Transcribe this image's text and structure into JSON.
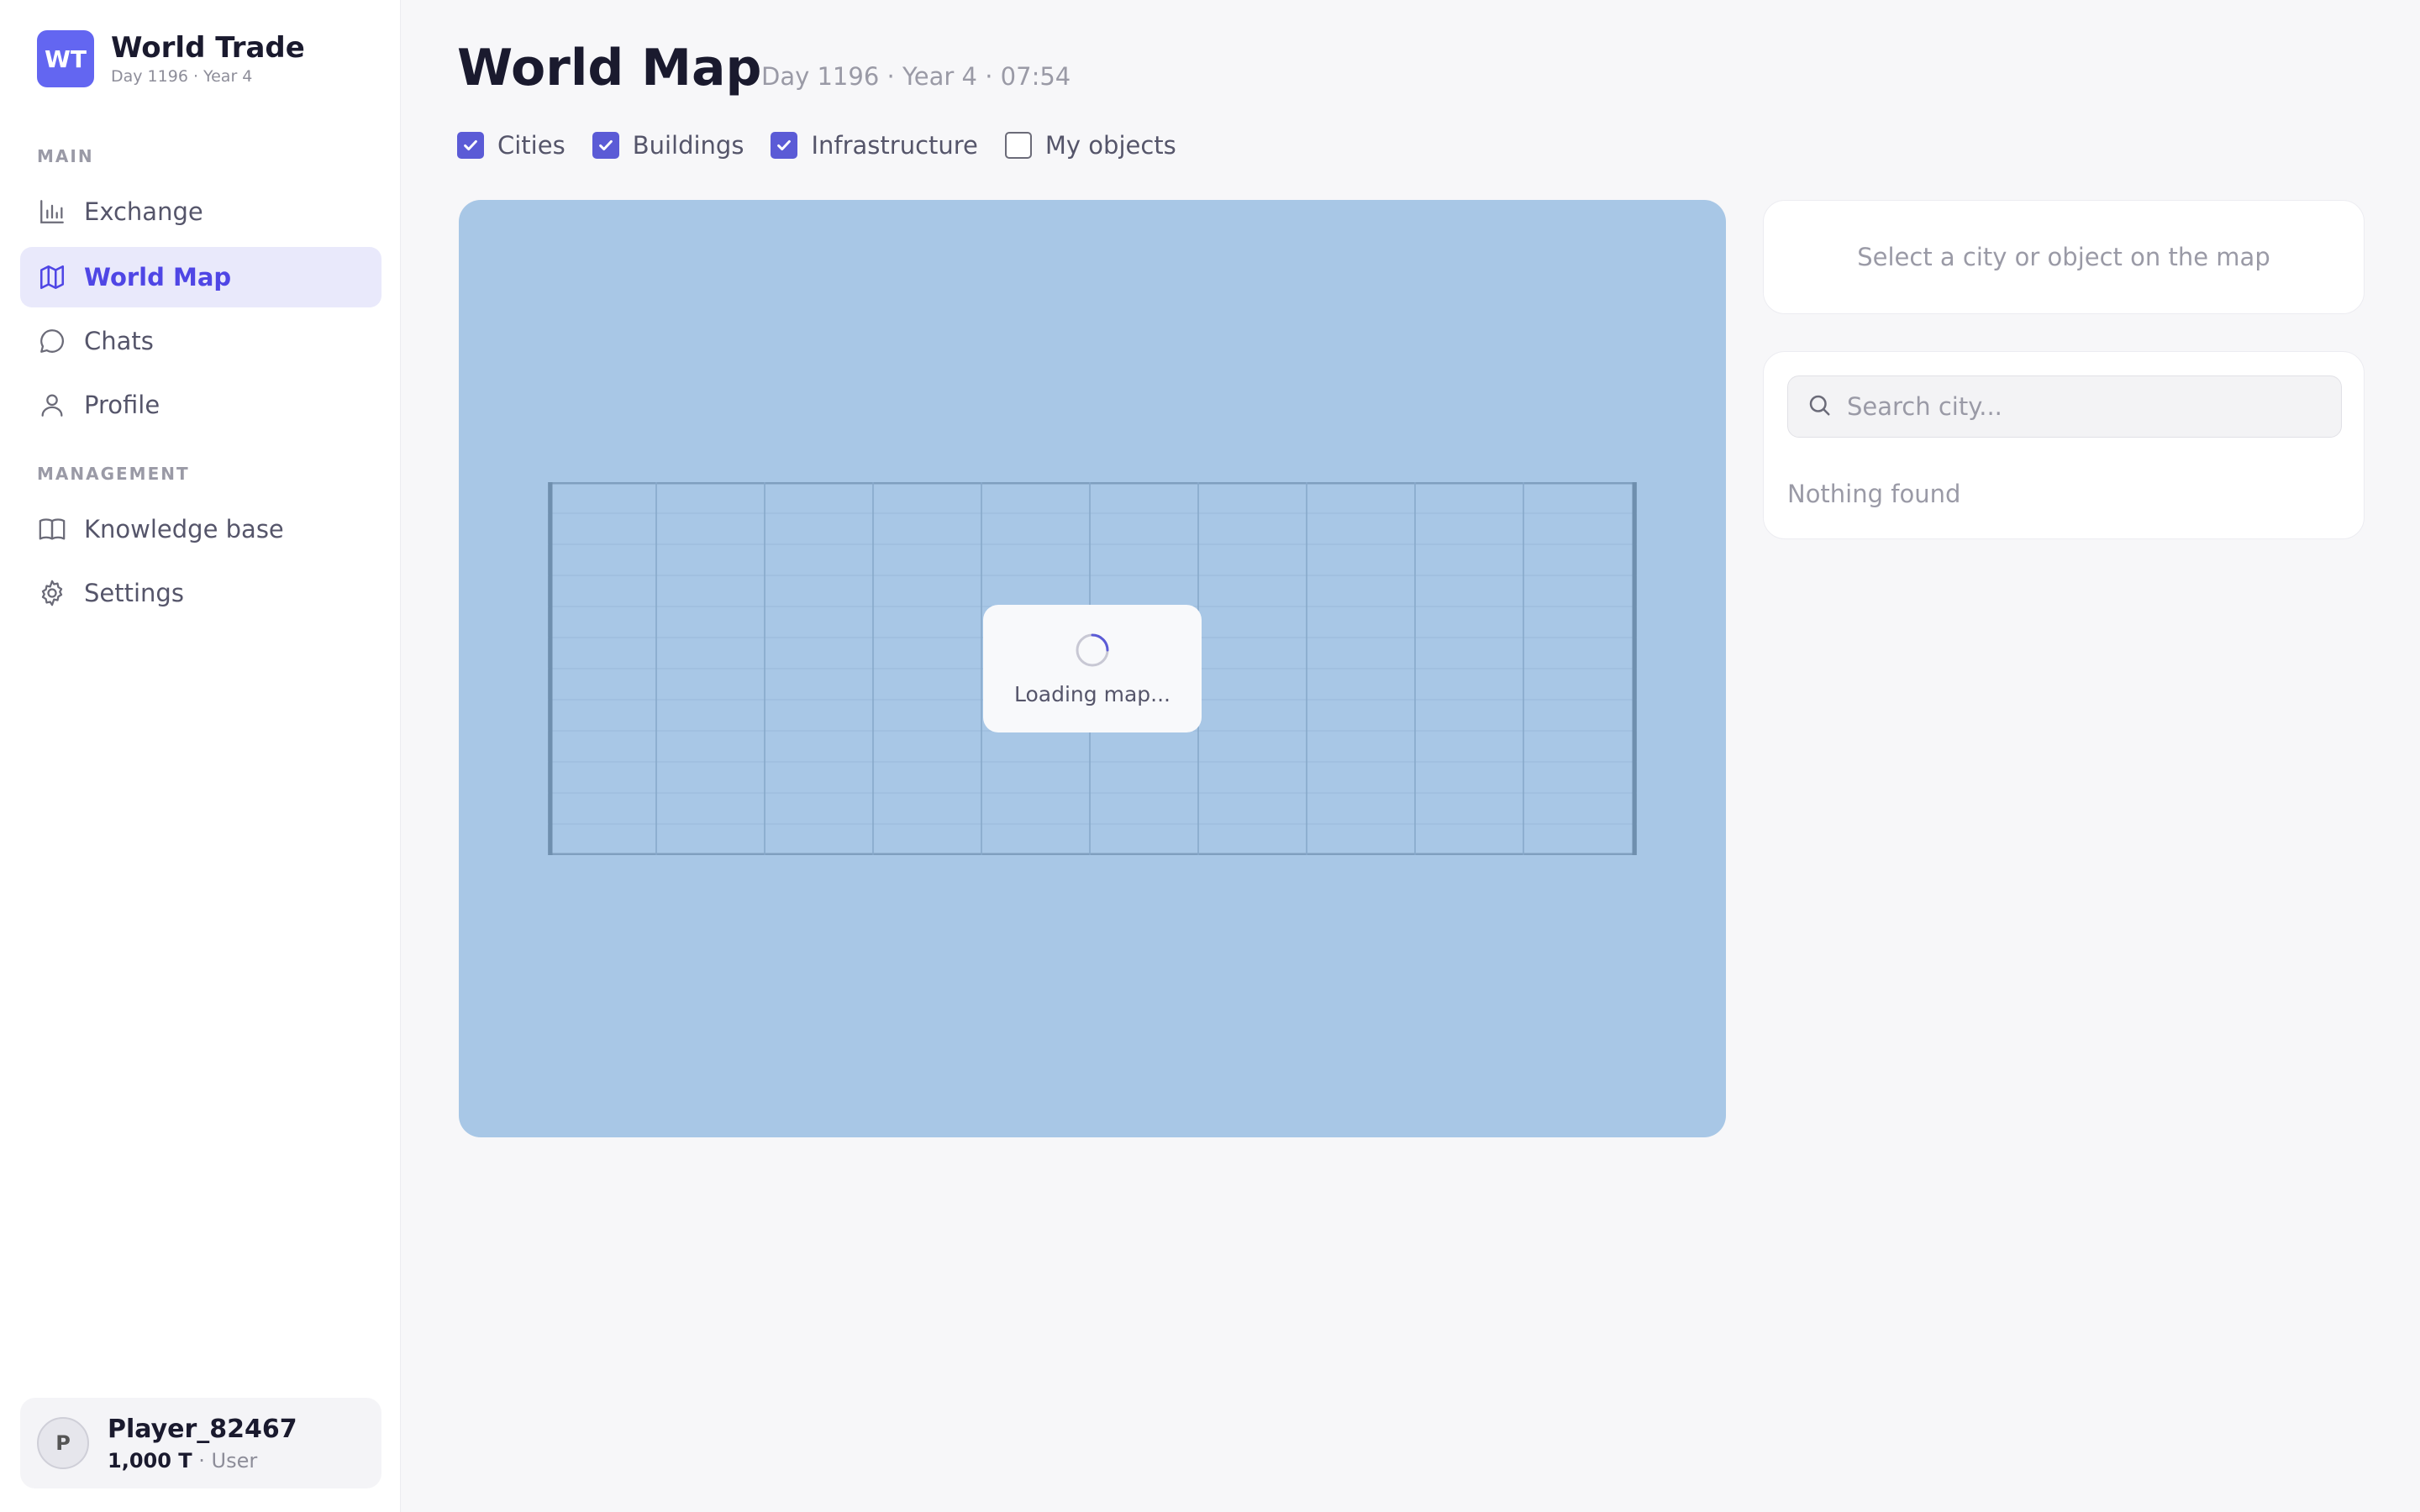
{
  "brand": {
    "logo_text": "WT",
    "title": "World Trade",
    "subtitle": "Day 1196 · Year 4"
  },
  "sidebar": {
    "sections": [
      {
        "label": "MAIN",
        "items": [
          {
            "label": "Exchange",
            "icon": "bar-chart-icon",
            "active": false
          },
          {
            "label": "World Map",
            "icon": "map-icon",
            "active": true
          },
          {
            "label": "Chats",
            "icon": "chat-bubble-icon",
            "active": false
          },
          {
            "label": "Profile",
            "icon": "user-icon",
            "active": false
          }
        ]
      },
      {
        "label": "MANAGEMENT",
        "items": [
          {
            "label": "Knowledge base",
            "icon": "book-icon",
            "active": false
          },
          {
            "label": "Settings",
            "icon": "gear-icon",
            "active": false
          }
        ]
      }
    ]
  },
  "user": {
    "avatar_initial": "P",
    "name": "Player_82467",
    "balance": "1,000 T",
    "role": "· User"
  },
  "header": {
    "title": "World Map",
    "subtitle": "Day 1196 · Year 4 · 07:54"
  },
  "filters": [
    {
      "label": "Cities",
      "checked": true
    },
    {
      "label": "Buildings",
      "checked": true
    },
    {
      "label": "Infrastructure",
      "checked": true
    },
    {
      "label": "My objects",
      "checked": false
    }
  ],
  "map": {
    "loading_text": "Loading map..."
  },
  "details_panel": {
    "hint": "Select a city or object on the map"
  },
  "search": {
    "placeholder": "Search city...",
    "value": "",
    "empty_text": "Nothing found"
  },
  "colors": {
    "accent": "#5b5bd6",
    "map_water": "#a8c7e6",
    "brand": "#6366f1"
  }
}
